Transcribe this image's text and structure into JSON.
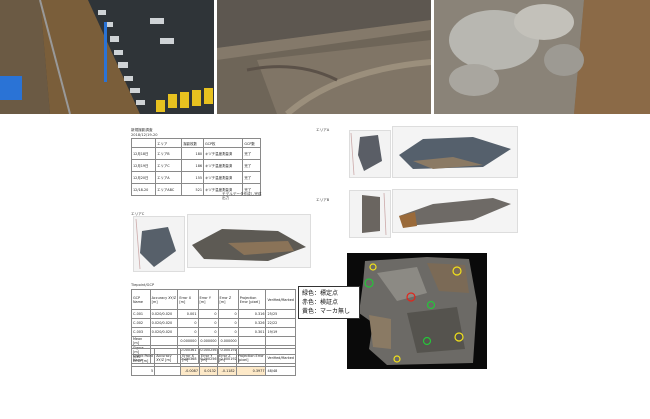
{
  "survey_table": {
    "title": "新規撮影調査",
    "date": "2018/12/19-20",
    "headers": [
      "",
      "エリア",
      "撮影枚数",
      "GCP枚",
      "GCP数"
    ],
    "rows": [
      [
        "12月18日",
        "エリアB",
        "180",
        "キヅチ温度測量済",
        "完了"
      ],
      [
        "12月19日",
        "エリアC",
        "186",
        "キヅチ温度測量済",
        "完了"
      ],
      [
        "12月20日",
        "エリアA",
        "155",
        "キヅチ温度測量済",
        "完了"
      ],
      [
        "12/18-20",
        "エリアABC",
        "521",
        "キヅチ温度測量済",
        "完了"
      ]
    ],
    "note": "モデルデータ作成し完成出力"
  },
  "area_labels": {
    "a": "エリアA",
    "b": "エリアB",
    "c": "エリアC"
  },
  "gcp_table": {
    "title": "Tiepoint/GCP",
    "headers": [
      "GCP Name",
      "Accuracy XY/Z [m]",
      "Error X [m]",
      "Error Y [m]",
      "Error Z [m]",
      "Projection Error [pixel]",
      "Verified/Marked"
    ],
    "rows": [
      [
        "C-001",
        "0.020/0.020",
        "0.001",
        "0",
        "0",
        "0.316",
        "25/25"
      ],
      [
        "C-002",
        "0.020/0.020",
        "0",
        "0",
        "0",
        "0.326",
        "22/22"
      ],
      [
        "C-003",
        "0.020/0.020",
        "0",
        "0",
        "0",
        "0.301",
        "19/19"
      ],
      [
        "Mean [m]",
        "",
        "0.000000",
        "0.000000",
        "0.000000",
        "",
        ""
      ],
      [
        "Sigma [m]",
        "",
        "0.000361",
        "0.000256",
        "0.000191",
        "",
        ""
      ],
      [
        "RMS Error [m]",
        "",
        "0.000368",
        "0.000256",
        "0.000192",
        "",
        ""
      ]
    ]
  },
  "check_table": {
    "headers": [
      "Check Point Name",
      "Accuracy XY/Z [m]",
      "Error X [m]",
      "Error Y [m]",
      "Error Z [m]",
      "Projection Error [pixel]",
      "Verified/Marked"
    ],
    "row": [
      "5",
      "",
      "-0.0087",
      "0.0132",
      "-0.1182",
      "0.3977",
      "48/48"
    ]
  },
  "legend": {
    "line1": "緑色：標定点",
    "line2": "赤色：検証点",
    "line3": "黄色：マーカ無し"
  },
  "colors": {
    "gcp": "#26c43a",
    "check": "#e0261c",
    "no_marker": "#f2e21a",
    "highlight": "#fde9c8"
  }
}
